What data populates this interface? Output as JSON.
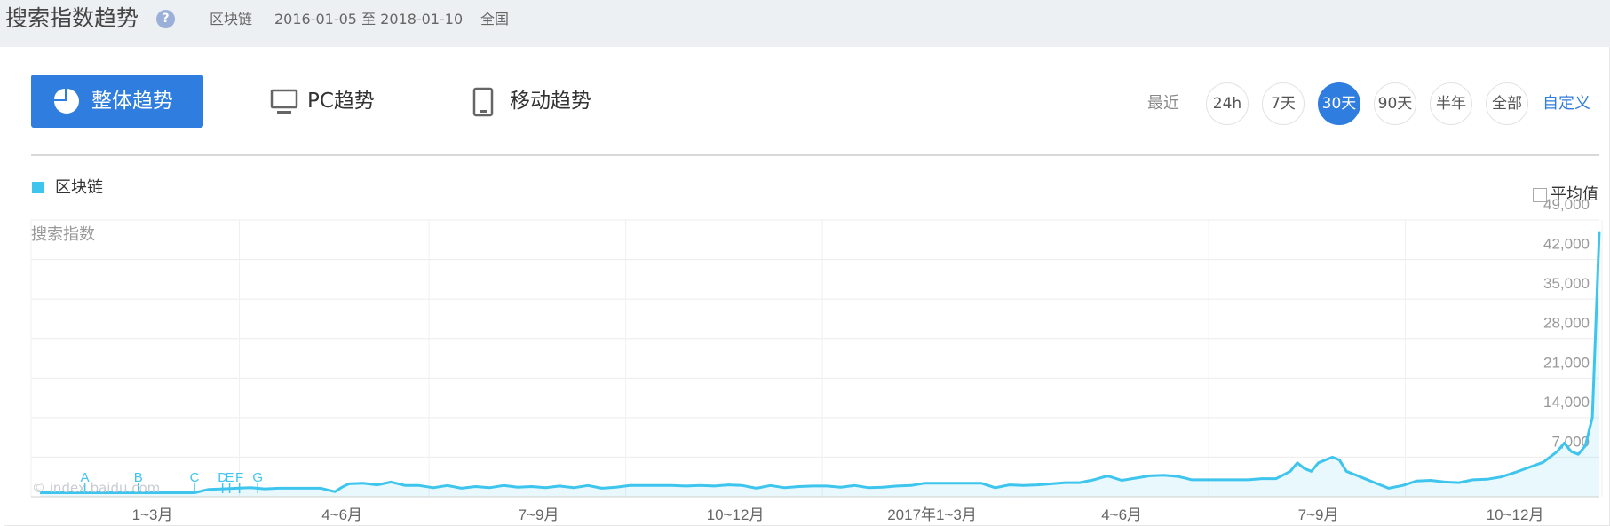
{
  "header": {
    "title": "搜索指数趋势",
    "help_glyph": "?",
    "keyword": "区块链",
    "date_range": "2016-01-05 至 2018-01-10",
    "region": "全国"
  },
  "tabs": [
    {
      "label": "整体趋势",
      "icon": "pie-chart-icon",
      "active": true
    },
    {
      "label": "PC趋势",
      "icon": "monitor-icon",
      "active": false
    },
    {
      "label": "移动趋势",
      "icon": "mobile-icon",
      "active": false
    }
  ],
  "range": {
    "label": "最近",
    "options": [
      "24h",
      "7天",
      "30天",
      "90天",
      "半年",
      "全部"
    ],
    "selected": "30天",
    "custom": "自定义"
  },
  "legend": {
    "label": "区块链",
    "average_label": "平均值",
    "average_checked": false
  },
  "colors": {
    "accent": "#2f7dde",
    "series": "#3ec5ee",
    "annotation": "#3ec5ee"
  },
  "watermark": "© index.baidu.com",
  "chart_data": {
    "type": "area",
    "ylabel": "搜索指数",
    "xlabel": "",
    "y_ticks": [
      "7,000",
      "14,000",
      "21,000",
      "28,000",
      "35,000",
      "42,000",
      "49,000"
    ],
    "y_tick_values": [
      7000,
      14000,
      21000,
      28000,
      35000,
      42000,
      49000
    ],
    "ylim": [
      0,
      49000
    ],
    "x_ticks": [
      "1~3月",
      "4~6月",
      "7~9月",
      "10~12月",
      "2017年1~3月",
      "4~6月",
      "7~9月",
      "10~12月"
    ],
    "x_tick_positions": [
      8,
      21.5,
      35.5,
      49.5,
      63.5,
      77,
      91,
      105
    ],
    "x_range": [
      0,
      111
    ],
    "grid": true,
    "legend": "top-left",
    "annotations": [
      {
        "label": "A",
        "x": 3.2
      },
      {
        "label": "B",
        "x": 7.0
      },
      {
        "label": "C",
        "x": 11.0
      },
      {
        "label": "D",
        "x": 13.0
      },
      {
        "label": "E",
        "x": 13.5
      },
      {
        "label": "F",
        "x": 14.2
      },
      {
        "label": "G",
        "x": 15.5
      }
    ],
    "series": [
      {
        "name": "区块链",
        "x": [
          0,
          3,
          6,
          9,
          11,
          12,
          13,
          14,
          15,
          16,
          17,
          18,
          19,
          20,
          21,
          21.5,
          22,
          23,
          24,
          25,
          26,
          27,
          28,
          29,
          30,
          31,
          32,
          33,
          34,
          35,
          36,
          37,
          38,
          39,
          40,
          41,
          42,
          43,
          44,
          45,
          46,
          47,
          48,
          49,
          50,
          51,
          52,
          53,
          54,
          55,
          56,
          57,
          58,
          59,
          60,
          61,
          62,
          63,
          64,
          65,
          66,
          67,
          68,
          69,
          70,
          71,
          72,
          73,
          74,
          75,
          76,
          77,
          78,
          79,
          80,
          81,
          82,
          83,
          84,
          85,
          86,
          87,
          88,
          89,
          89.5,
          90,
          90.5,
          91,
          92,
          92.5,
          93,
          94,
          95,
          96,
          97,
          98,
          99,
          100,
          101,
          102,
          103,
          104,
          105,
          106,
          107,
          108,
          108.5,
          109,
          109.5,
          110,
          110.5,
          111
        ],
        "values": [
          700,
          700,
          700,
          700,
          700,
          1300,
          1400,
          1500,
          1600,
          1400,
          1500,
          1500,
          1500,
          1500,
          900,
          1700,
          2300,
          2400,
          2100,
          2600,
          2000,
          2000,
          1600,
          2000,
          1500,
          1800,
          1600,
          2000,
          1700,
          1800,
          1600,
          1900,
          1600,
          2000,
          1500,
          1700,
          2000,
          2000,
          2000,
          2000,
          1900,
          2000,
          1900,
          2100,
          2000,
          1500,
          2000,
          1600,
          1800,
          1900,
          1900,
          1700,
          2000,
          1600,
          1700,
          1900,
          2000,
          2400,
          2400,
          2400,
          2400,
          2400,
          1600,
          2100,
          2000,
          2100,
          2300,
          2500,
          2500,
          3000,
          3700,
          2900,
          3300,
          3700,
          3800,
          3600,
          3000,
          3000,
          3000,
          3000,
          3000,
          3200,
          3200,
          4500,
          6000,
          5000,
          4500,
          6000,
          7000,
          6500,
          4500,
          3500,
          2500,
          1500,
          2000,
          2800,
          2900,
          2600,
          2500,
          3000,
          3100,
          3500,
          4300,
          5200,
          6100,
          8000,
          9500,
          8000,
          7500,
          9000,
          14000,
          47000
        ]
      }
    ]
  }
}
